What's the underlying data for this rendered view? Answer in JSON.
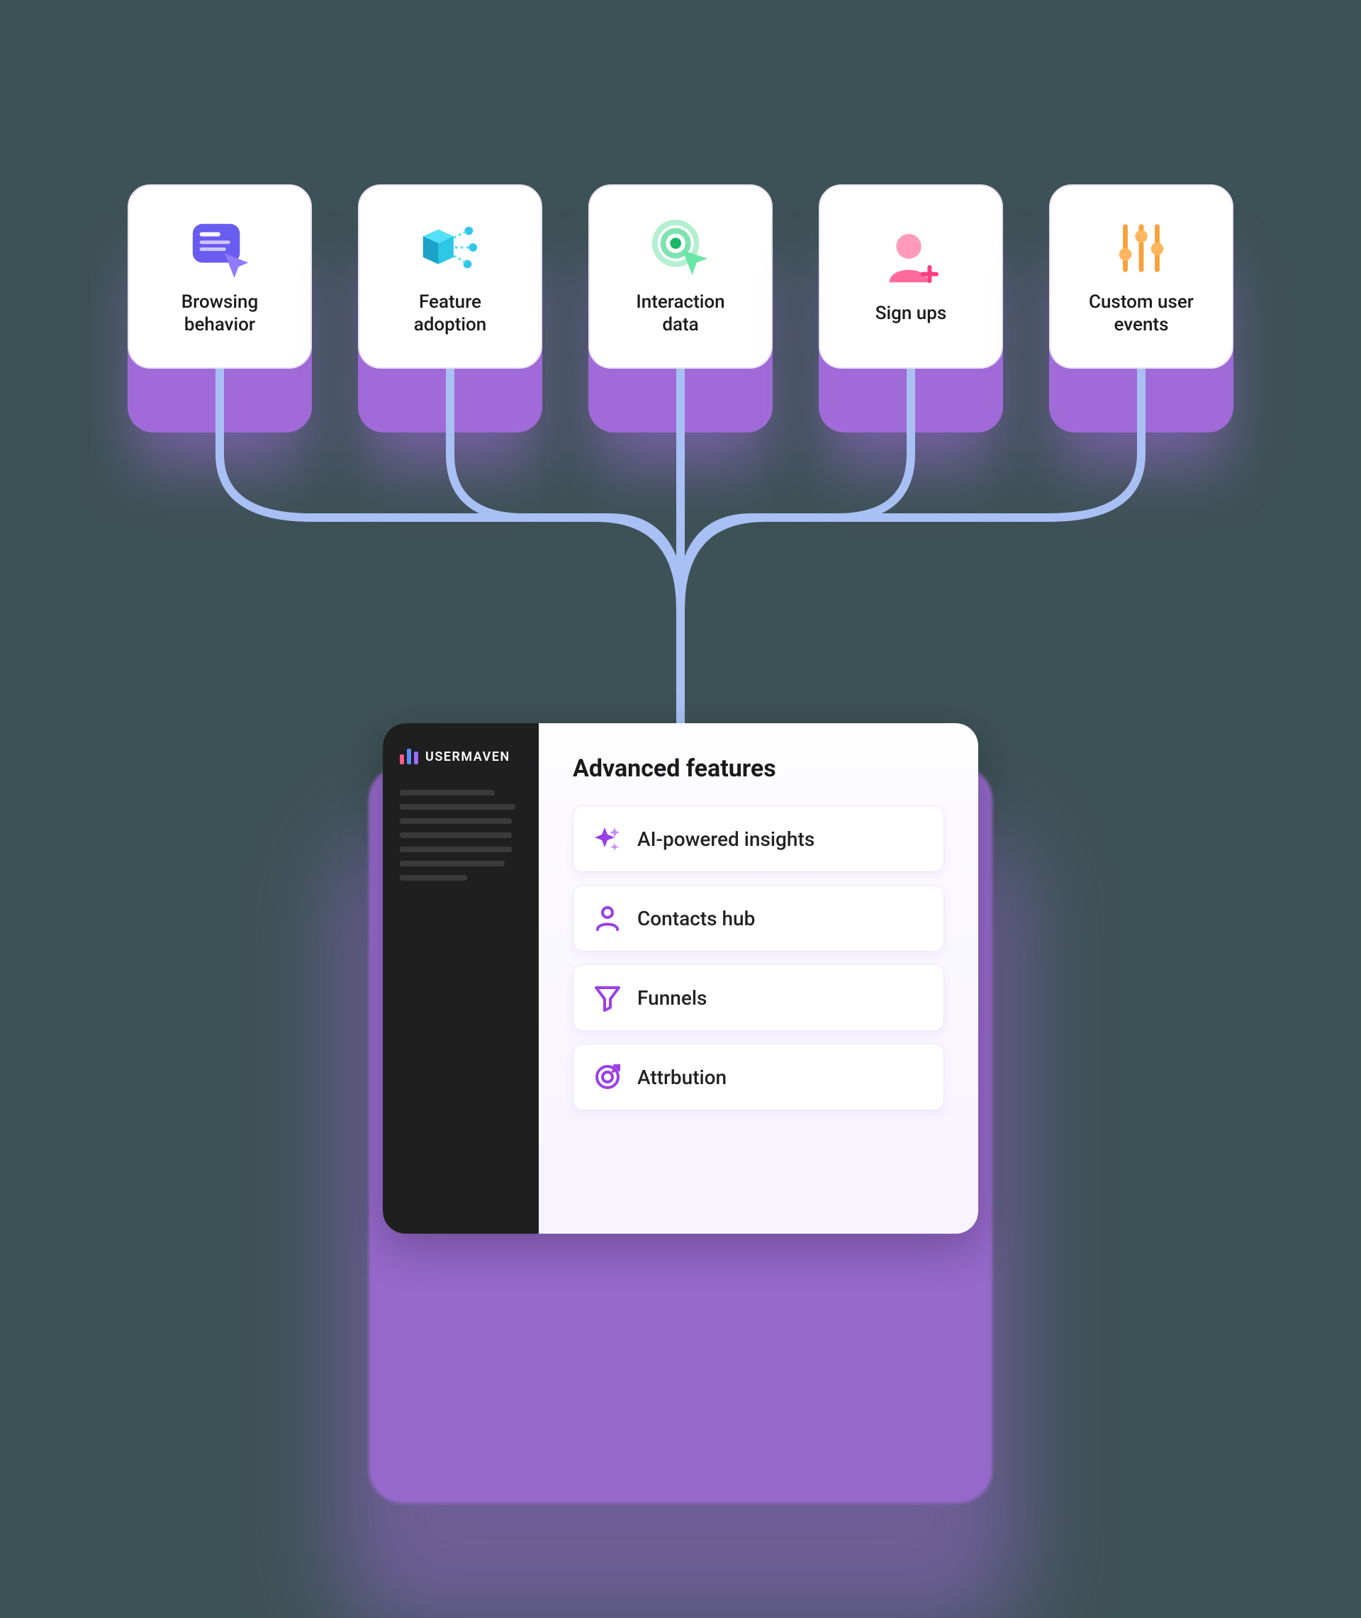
{
  "sources": [
    {
      "key": "browsing-behavior",
      "label": "Browsing\nbehavior",
      "icon": "window-cursor"
    },
    {
      "key": "feature-adoption",
      "label": "Feature\nadoption",
      "icon": "cube-nodes"
    },
    {
      "key": "interaction-data",
      "label": "Interaction\ndata",
      "icon": "radar-cursor"
    },
    {
      "key": "sign-ups",
      "label": "Sign ups",
      "icon": "person-plus"
    },
    {
      "key": "custom-user-events",
      "label": "Custom user\nevents",
      "icon": "sliders"
    }
  ],
  "panel": {
    "brand": "USERMAVEN",
    "title": "Advanced features",
    "features": [
      {
        "key": "ai-insights",
        "icon": "sparkle",
        "label": "AI-powered insights"
      },
      {
        "key": "contacts-hub",
        "icon": "person",
        "label": "Contacts hub"
      },
      {
        "key": "funnels",
        "icon": "funnel",
        "label": "Funnels"
      },
      {
        "key": "attribution",
        "icon": "target",
        "label": "Attrbution"
      }
    ]
  },
  "colors": {
    "accent": "#9b3fe6",
    "connector": "#a9c0f5",
    "tile": "#a06bd8"
  }
}
